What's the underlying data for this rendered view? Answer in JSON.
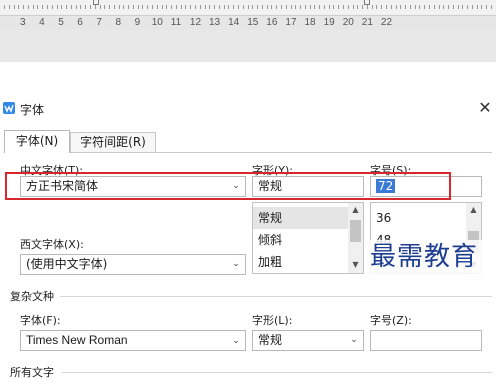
{
  "ruler": {
    "numbers": [
      "3",
      "4",
      "5",
      "6",
      "7",
      "8",
      "9",
      "10",
      "11",
      "12",
      "13",
      "14",
      "15",
      "16",
      "17",
      "18",
      "19",
      "20",
      "21",
      "22"
    ]
  },
  "dialog": {
    "title": "字体",
    "close_glyph": "✕",
    "tabs": [
      {
        "label": "字体(N)",
        "active": true
      },
      {
        "label": "字符间距(R)",
        "active": false
      }
    ],
    "chinese_font": {
      "label": "中文字体(T):",
      "value": "方正书宋简体"
    },
    "style": {
      "label": "字形(Y):",
      "value": "常规",
      "options": [
        "常规",
        "倾斜",
        "加粗"
      ],
      "selected": "常规"
    },
    "size": {
      "label": "字号(S):",
      "value": "72",
      "options": [
        "36",
        "48",
        "72"
      ],
      "selected": "72"
    },
    "western_font": {
      "label": "西文字体(X):",
      "value": "(使用中文字体)"
    },
    "complex": {
      "section_title": "复杂文种",
      "font_label": "字体(F):",
      "font_value": "Times New Roman",
      "style_label": "字形(L):",
      "style_value": "常规",
      "size_label": "字号(Z):"
    },
    "all_text": {
      "section_title": "所有文字"
    }
  },
  "watermark": {
    "text": "最需教育"
  },
  "colors": {
    "highlight": "#d6262e",
    "selection": "#3a7bd5",
    "watermark": "#1d3d8f",
    "app_icon": "#2f8be6"
  }
}
